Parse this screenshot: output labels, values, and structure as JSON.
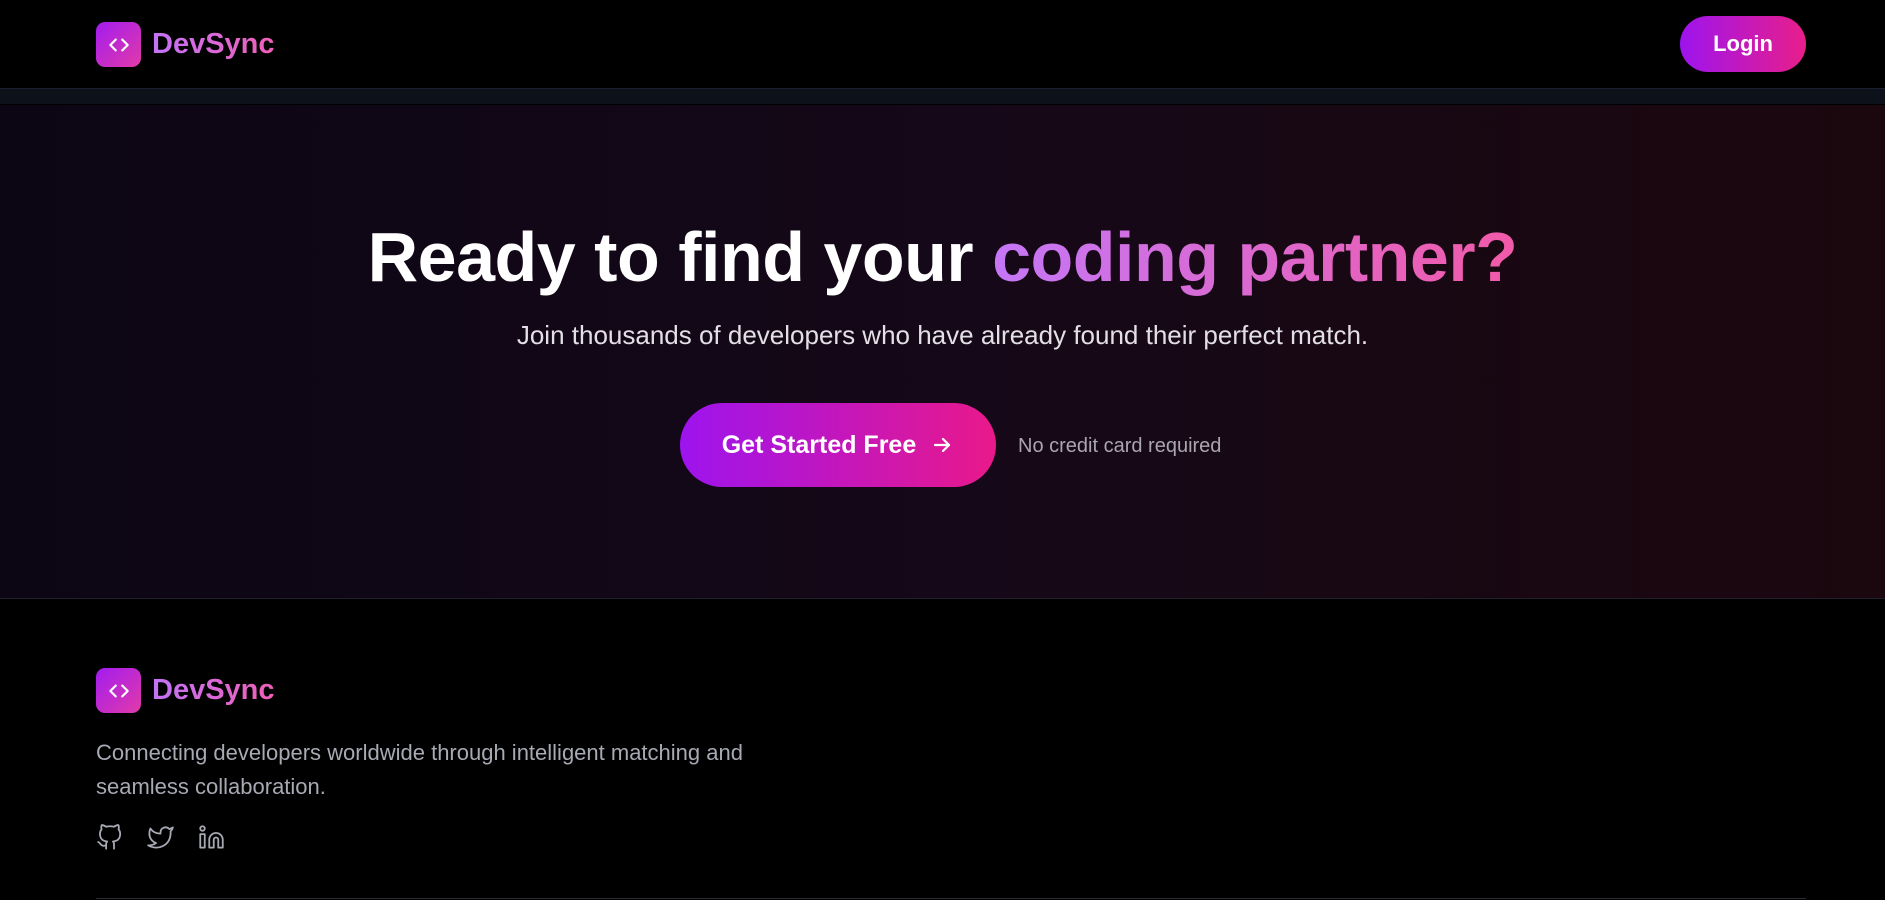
{
  "nav": {
    "brand": "DevSync",
    "logo_icon": "code-brackets-icon",
    "login_label": "Login"
  },
  "hero": {
    "headline_plain": "Ready to find your ",
    "headline_accent": "coding partner?",
    "subline": "Join thousands of developers who have already found their perfect match.",
    "cta_label": "Get Started Free",
    "cta_icon": "arrow-right-icon",
    "note": "No credit card required"
  },
  "footer": {
    "brand": "DevSync",
    "description": "Connecting developers worldwide through intelligent matching and seamless collaboration.",
    "social_icons": [
      "github-icon",
      "twitter-icon",
      "linkedin-icon"
    ]
  },
  "colors": {
    "gradient_start": "#9d14ee",
    "gradient_end": "#e91e8a",
    "accent_text_start": "#c577f6",
    "accent_text_end": "#f25aa9",
    "background": "#000000"
  }
}
